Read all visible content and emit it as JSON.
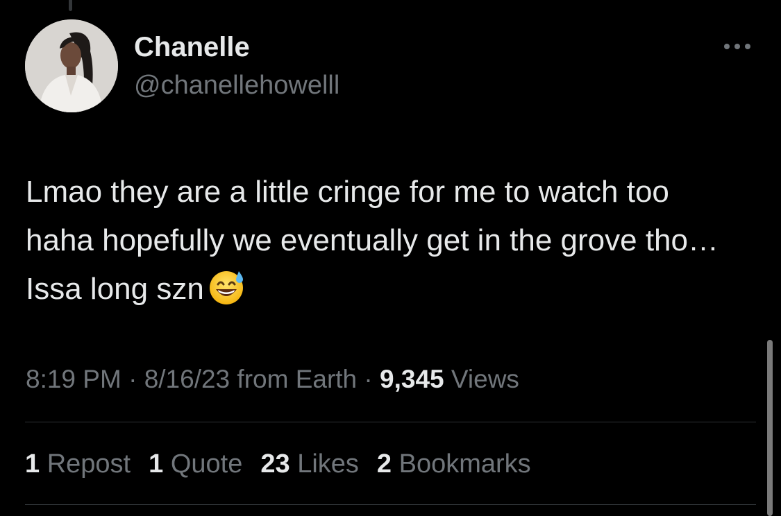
{
  "tweet": {
    "author": {
      "name": "Chanelle",
      "handle": "@chanellehowelll"
    },
    "text": "Lmao they are a little cringe for me to watch too haha hopefully we eventually get in the grove tho… Issa long szn",
    "emoji": "grinning-face-with-sweat-icon",
    "time": "8:19 PM",
    "date": "8/16/23",
    "source": "from Earth",
    "separator": "·",
    "views_count": "9,345",
    "views_label": "Views"
  },
  "stats": [
    {
      "count": "1",
      "label": "Repost"
    },
    {
      "count": "1",
      "label": "Quote"
    },
    {
      "count": "23",
      "label": "Likes"
    },
    {
      "count": "2",
      "label": "Bookmarks"
    }
  ],
  "icons": {
    "more": "more-options-icon"
  },
  "colors": {
    "background": "#000000",
    "primary_text": "#e7e9ea",
    "secondary_text": "#71767b",
    "divider": "#2f3336"
  }
}
